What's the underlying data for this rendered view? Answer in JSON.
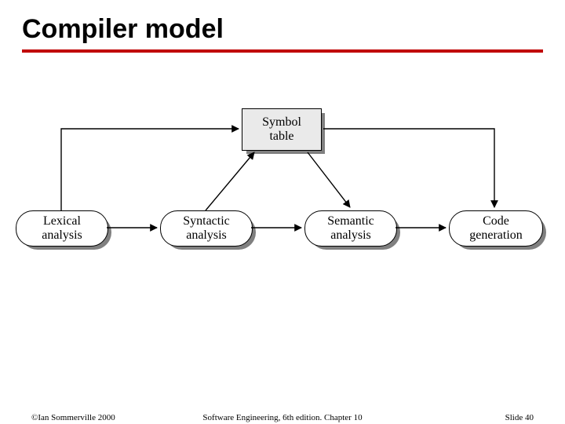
{
  "title": "Compiler model",
  "nodes": {
    "symbol_table": "Symbol\ntable",
    "lexical": "Lexical\nanalysis",
    "syntactic": "Syntactic\nanalysis",
    "semantic": "Semantic\nanalysis",
    "codegen": "Code\ngeneration"
  },
  "footer": {
    "left": "©Ian Sommerville 2000",
    "center": "Software Engineering, 6th edition. Chapter 10",
    "right": "Slide 40"
  }
}
